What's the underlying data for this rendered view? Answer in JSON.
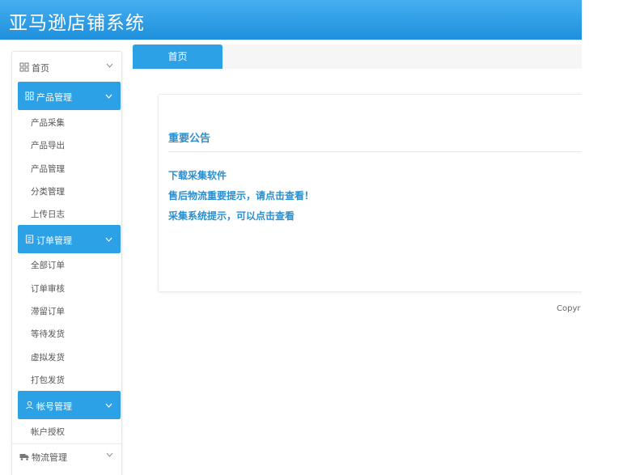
{
  "header": {
    "title": "亚马逊店铺系统",
    "background": "#2a9be3"
  },
  "sidebar": {
    "home": {
      "label": "首页",
      "icon": "grid-icon"
    },
    "product": {
      "label": "产品管理",
      "icon": "grid-icon",
      "items": [
        "产品采集",
        "产品导出",
        "产品管理",
        "分类管理",
        "上传日志"
      ]
    },
    "order": {
      "label": "订单管理",
      "icon": "document-icon",
      "items": [
        "全部订单",
        "订单审核",
        "滞留订单",
        "等待发货",
        "虚拟发货",
        "打包发货"
      ]
    },
    "account": {
      "label": "帐号管理",
      "icon": "user-icon",
      "items": [
        "帐户授权"
      ]
    },
    "logistics": {
      "label": "物流管理",
      "icon": "truck-icon"
    }
  },
  "tabs": [
    {
      "label": "首页",
      "active": true
    }
  ],
  "announcement": {
    "title": "重要公告",
    "items": [
      "下载采集软件",
      "售后物流重要提示，请点击查看！",
      "采集系统提示，可以点击查看"
    ]
  },
  "footer": {
    "copyright": "Copyr"
  },
  "colors": {
    "accent": "#2da1e6",
    "link": "#2a8fcf"
  }
}
